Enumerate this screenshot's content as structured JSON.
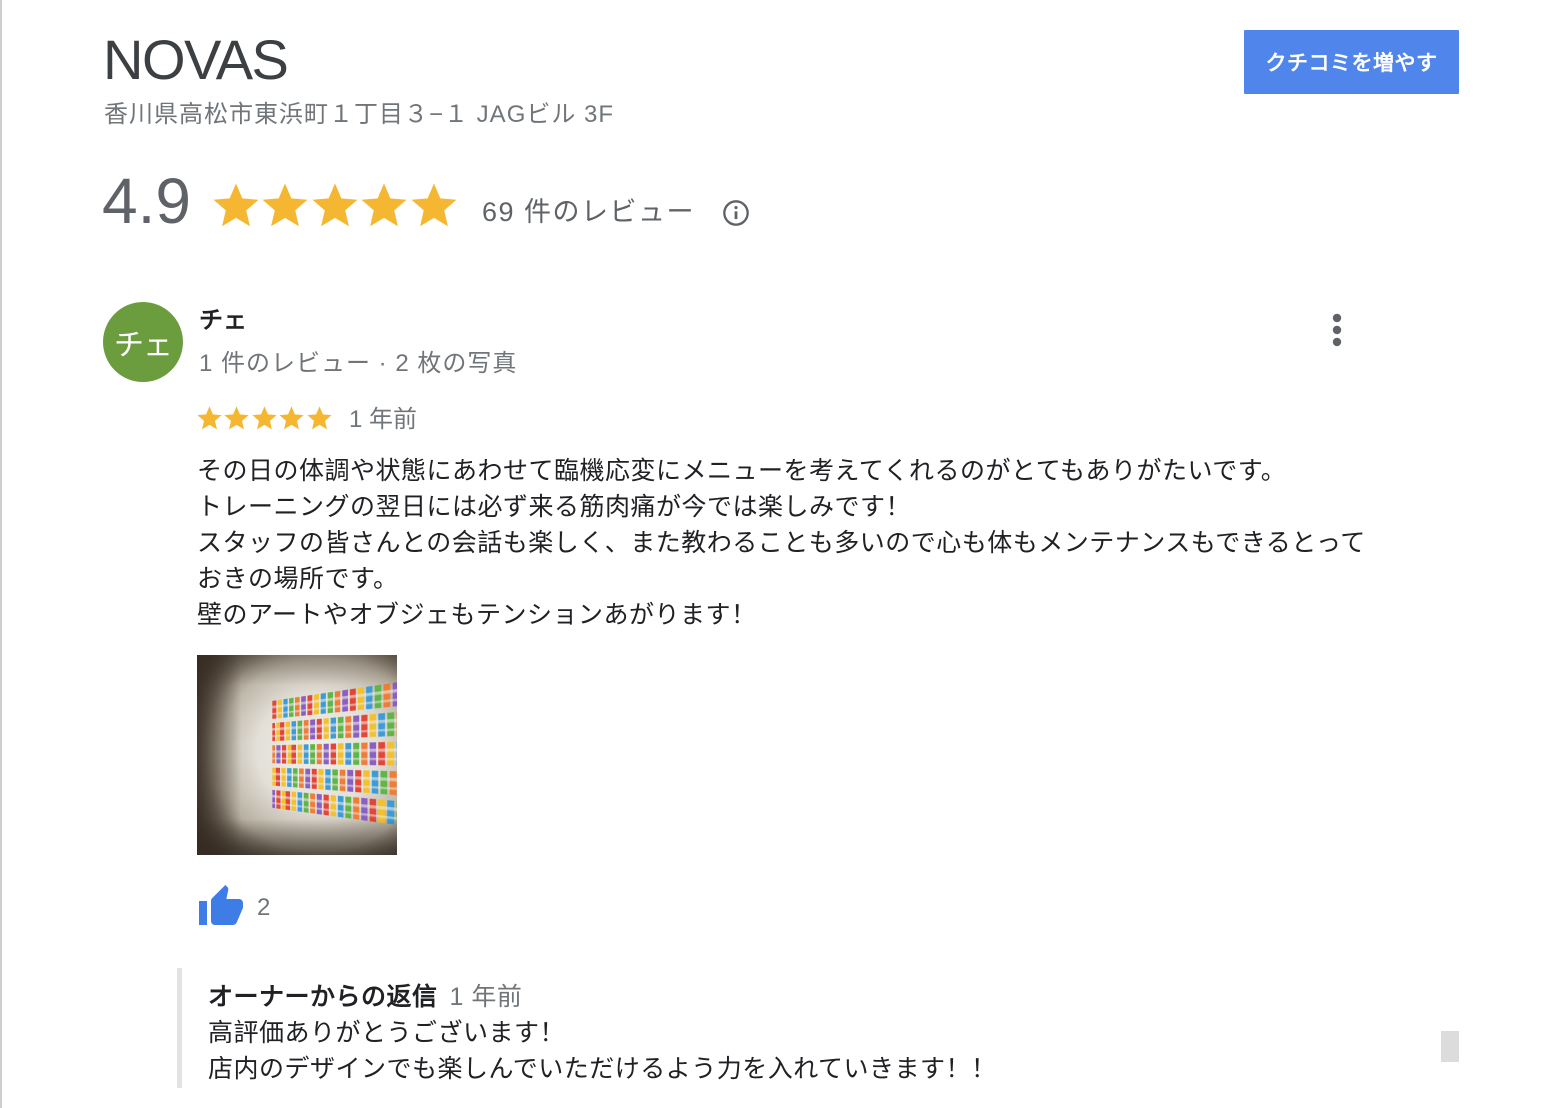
{
  "colors": {
    "accent": "#5086ec",
    "star": "#f5b731",
    "avatar": "#6b9d3f",
    "like": "#3e7de6",
    "text_primary": "#202124",
    "text_secondary": "#70757a",
    "text_muted": "#5f6368"
  },
  "icons": {
    "star": "star-icon",
    "info": "info-icon",
    "menu": "more-vert-icon",
    "like": "thumb-up-icon"
  },
  "place": {
    "name": "NOVAS",
    "address": "香川県高松市東浜町１丁目３−１ JAGビル 3F",
    "add_reviews_button": "クチコミを増やす",
    "rating": "4.9",
    "stars_filled": 5,
    "review_count": "69 件のレビュー"
  },
  "review": {
    "avatar_text": "チェ",
    "author": "チェ",
    "author_meta": "1 件のレビュー · 2 枚の写真",
    "stars_filled": 5,
    "time": "1 年前",
    "text_lines": [
      "その日の体調や状態にあわせて臨機応変にメニューを考えてくれるのがとてもありがたいです。",
      "トレーニングの翌日には必ず来る筋肉痛が今では楽しみです！",
      "スタッフの皆さんとの会話も楽しく、また教わることも多いので心も体もメンテナンスもできるとって",
      "おきの場所です。",
      "壁のアートやオブジェもテンションあがります！"
    ],
    "likes": "2",
    "owner_reply": {
      "label": "オーナーからの返信",
      "time": "1 年前",
      "text_lines": [
        "高評価ありがとうございます！",
        "店内のデザインでも楽しんでいただけるよう力を入れていきます！！"
      ]
    }
  }
}
